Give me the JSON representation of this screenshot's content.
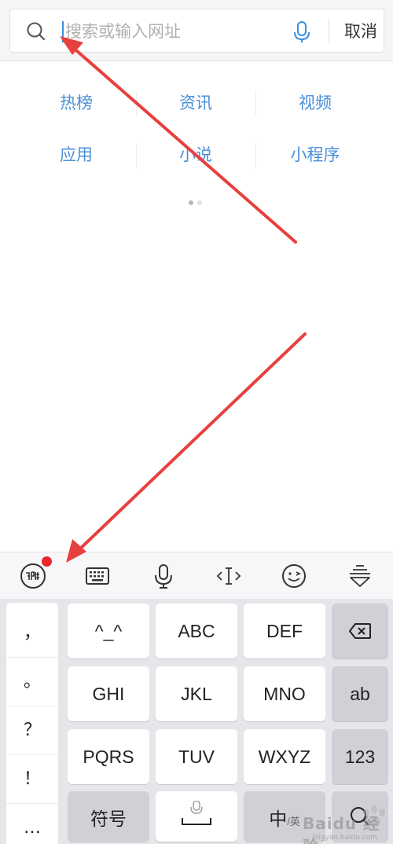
{
  "search": {
    "placeholder": "搜索或输入网址",
    "cancel_label": "取消"
  },
  "categories": [
    [
      "热榜",
      "资讯",
      "视频"
    ],
    [
      "应用",
      "小说",
      "小程序"
    ]
  ],
  "pager": {
    "page_count": 2,
    "active_index": 0
  },
  "toolbar": {
    "icons": [
      "ime-logo-icon",
      "keyboard-icon",
      "microphone-icon",
      "cursor-icon",
      "emoji-icon",
      "collapse-keyboard-icon"
    ],
    "has_notification_dot": true
  },
  "keyboard": {
    "punctuation": [
      "，",
      "。",
      "？",
      "！",
      "…"
    ],
    "rows": [
      [
        "^_^",
        "ABC",
        "DEF"
      ],
      [
        "GHI",
        "JKL",
        "MNO"
      ],
      [
        "PQRS",
        "TUV",
        "WXYZ"
      ]
    ],
    "side_keys": [
      "ab",
      "123"
    ],
    "symbol_label": "符号",
    "lang_main": "中",
    "lang_sub": "/英"
  },
  "watermark": {
    "text": "Baidu 经验",
    "sub": "jingyan.baidu.com"
  },
  "colors": {
    "link_blue": "#4a90d9",
    "annotation_red": "#e8403f",
    "notification_red": "#e8262b"
  }
}
